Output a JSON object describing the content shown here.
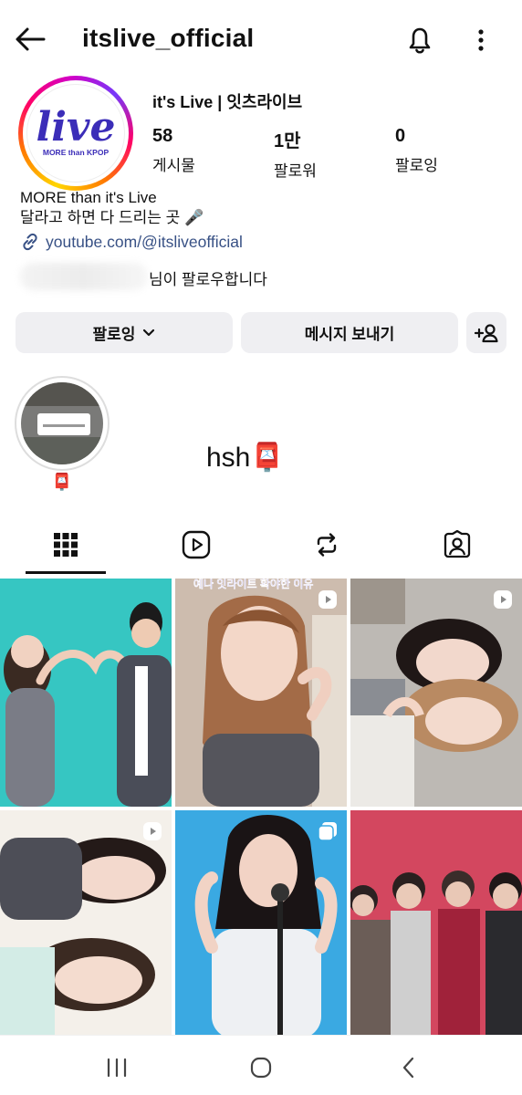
{
  "header": {
    "username": "itslive_official"
  },
  "profile": {
    "logo_word": "live",
    "logo_sub": "MORE than KPOP",
    "name": "it's Live | 잇츠라이브",
    "stats": [
      {
        "num": "58",
        "label": "게시물"
      },
      {
        "num": "1만",
        "label": "팔로워"
      },
      {
        "num": "0",
        "label": "팔로잉"
      }
    ],
    "bio": [
      "MORE than it's Live",
      "달라고 하면 다 드리는 곳 🎤"
    ],
    "link": "youtube.com/@itsliveofficial",
    "followed_by": "님이 팔로우합니다"
  },
  "actions": {
    "following": "팔로잉",
    "message": "메시지 보내기"
  },
  "highlight": {
    "label": "📮",
    "caption": "hsh📮"
  },
  "tabs": [
    "grid-icon",
    "reels-icon",
    "reposts-icon",
    "tagged-icon"
  ],
  "posts": [
    {
      "kind": "photo",
      "bg": "#36c6c2"
    },
    {
      "kind": "reel",
      "bg": "#d8c9bc",
      "caption": "예나 잇라이트 확야한 이유"
    },
    {
      "kind": "reel",
      "bg": "#b9b6b2"
    },
    {
      "kind": "reel",
      "bg": "#f3efe9"
    },
    {
      "kind": "carousel",
      "bg": "#38a6e0"
    },
    {
      "kind": "photo",
      "bg": "#d2455d"
    }
  ],
  "colors": {
    "link": "#385185",
    "button_bg": "#efeff2",
    "logo": "#3b2db8"
  }
}
